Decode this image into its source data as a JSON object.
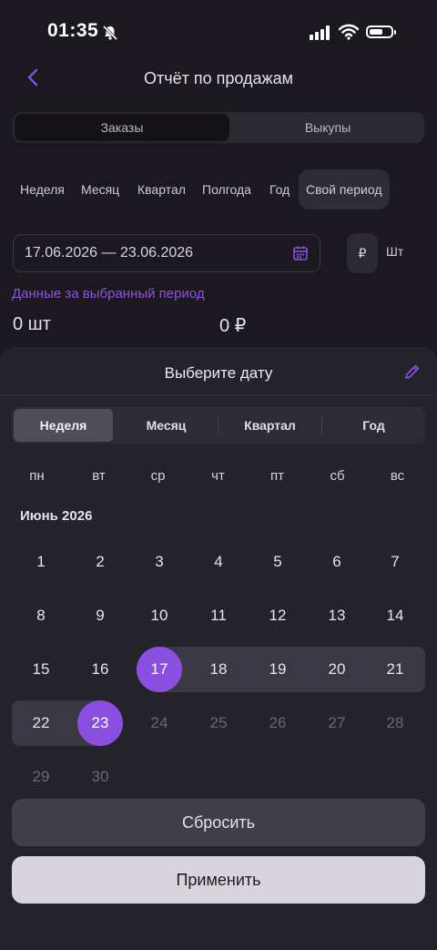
{
  "status_bar": {
    "time": "01:35"
  },
  "nav": {
    "title": "Отчёт по продажам"
  },
  "order_tabs": [
    "Заказы",
    "Выкупы"
  ],
  "periods": [
    "Неделя",
    "Месяц",
    "Квартал",
    "Полгода",
    "Год",
    "Свой период"
  ],
  "date_range": {
    "value": "17.06.2026 — 23.06.2026"
  },
  "units": {
    "currency": "₽",
    "pieces": "Шт"
  },
  "period_caption": "Данные за выбранный период",
  "stats": {
    "count": "0 шт",
    "sum": "0 ₽"
  },
  "sheet": {
    "title": "Выберите дату",
    "tabs": [
      "Неделя",
      "Месяц",
      "Квартал",
      "Год"
    ],
    "weekdays": [
      "пн",
      "вт",
      "ср",
      "чт",
      "пт",
      "сб",
      "вс"
    ],
    "month_label": "Июнь 2026",
    "days": [
      [
        "1",
        "2",
        "3",
        "4",
        "5",
        "6",
        "7"
      ],
      [
        "8",
        "9",
        "10",
        "11",
        "12",
        "13",
        "14"
      ],
      [
        "15",
        "16",
        "17",
        "18",
        "19",
        "20",
        "21"
      ],
      [
        "22",
        "23",
        "24",
        "25",
        "26",
        "27",
        "28"
      ],
      [
        "29",
        "30"
      ]
    ],
    "selected_start": "17",
    "selected_end": "23",
    "reset_label": "Сбросить",
    "apply_label": "Применить"
  },
  "colors": {
    "accent": "#8a4ee0",
    "background": "#1b191f",
    "sheet": "#25232a"
  }
}
